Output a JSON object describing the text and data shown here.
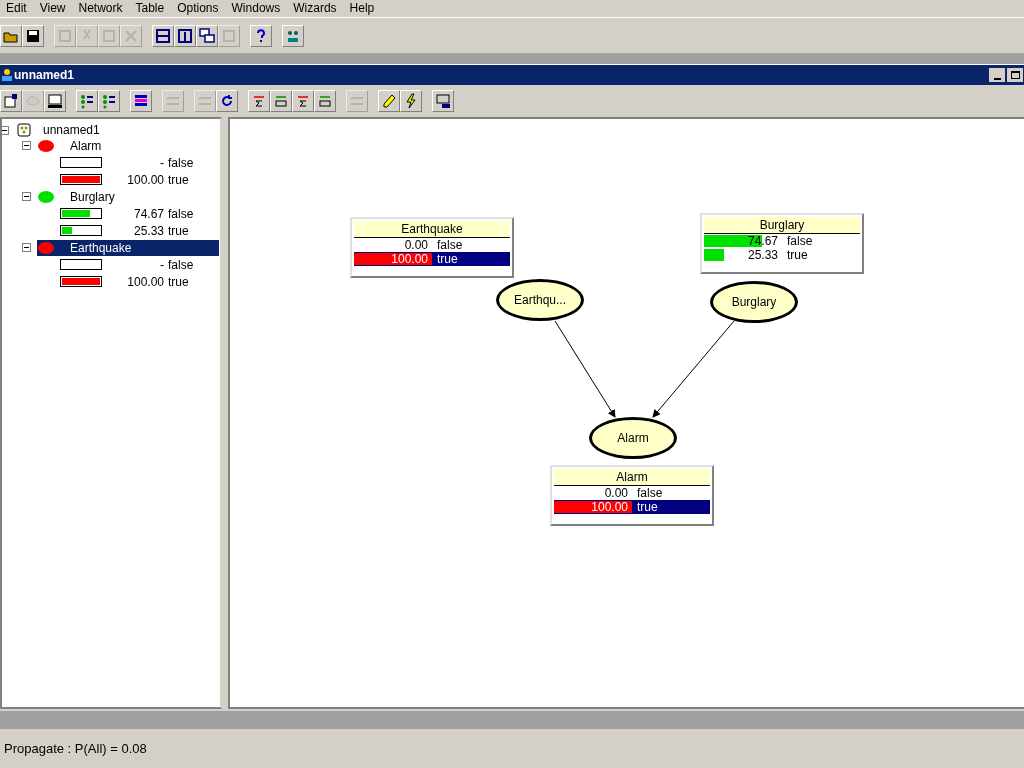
{
  "menu": [
    "Edit",
    "View",
    "Network",
    "Table",
    "Options",
    "Windows",
    "Wizards",
    "Help"
  ],
  "toolbar": [
    {
      "disabled": false
    },
    {
      "disabled": false
    },
    {
      "disabled": true
    },
    {
      "disabled": true
    },
    {
      "disabled": true
    },
    {
      "disabled": true
    },
    {
      "disabled": false
    },
    {
      "disabled": false
    },
    {
      "disabled": false
    },
    {
      "disabled": true
    },
    {
      "disabled": false
    },
    {
      "disabled": false
    }
  ],
  "window": {
    "title": "unnamed1"
  },
  "network_toolbar": [
    {
      "disabled": false
    },
    {
      "disabled": true
    },
    {
      "disabled": false
    },
    {
      "disabled": false
    },
    {
      "disabled": false
    },
    {
      "disabled": false
    },
    {
      "disabled": true
    },
    {
      "disabled": true
    },
    {
      "disabled": false
    },
    {
      "disabled": false
    },
    {
      "disabled": false
    },
    {
      "disabled": false
    },
    {
      "disabled": false
    },
    {
      "disabled": true
    },
    {
      "disabled": false
    },
    {
      "disabled": false
    },
    {
      "disabled": false
    }
  ],
  "tree": {
    "label": "unnamed1",
    "children": [
      {
        "label": "Alarm",
        "color": "#ff0000",
        "selected": false,
        "children": [
          {
            "probability": "-",
            "state": "false"
          },
          {
            "probability": "100.00",
            "state": "true",
            "level": 1
          }
        ]
      },
      {
        "label": "Burglary",
        "color": "#00e000",
        "selected": false,
        "children": [
          {
            "probability": "74.67",
            "state": "false",
            "level": 0.7467
          },
          {
            "probability": "25.33",
            "state": "true",
            "level": 0.2533
          }
        ]
      },
      {
        "label": "Earthquake",
        "color": "#ff0000",
        "selected": true,
        "children": [
          {
            "probability": "-",
            "state": "false"
          },
          {
            "probability": "100.00",
            "state": "true",
            "level": 1
          }
        ]
      }
    ]
  },
  "canvas": {
    "nodes": [
      {
        "label": "Earthqu...",
        "monitor": {
          "title": "Earthquake",
          "color": "#ff0000",
          "states": [
            {
              "probability": "0.00",
              "state": "false",
              "selected": false
            },
            {
              "probability": "100.00",
              "state": "true",
              "level": 1,
              "selected": true
            }
          ]
        }
      },
      {
        "label": "Burglary",
        "monitor": {
          "title": "Burglary",
          "color": "#00e000",
          "states": [
            {
              "probability": "74.67",
              "state": "false",
              "level": 0.7467,
              "selected": false
            },
            {
              "probability": "25.33",
              "state": "true",
              "level": 0.2533,
              "selected": false
            }
          ]
        }
      },
      {
        "label": "Alarm",
        "monitor": {
          "title": "Alarm",
          "color": "#ff0000",
          "states": [
            {
              "probability": "0.00",
              "state": "false",
              "selected": false
            },
            {
              "probability": "100.00",
              "state": "true",
              "level": 1,
              "selected": true
            }
          ]
        }
      }
    ]
  },
  "status_bar": "Propagate : P(All) =  0.08"
}
